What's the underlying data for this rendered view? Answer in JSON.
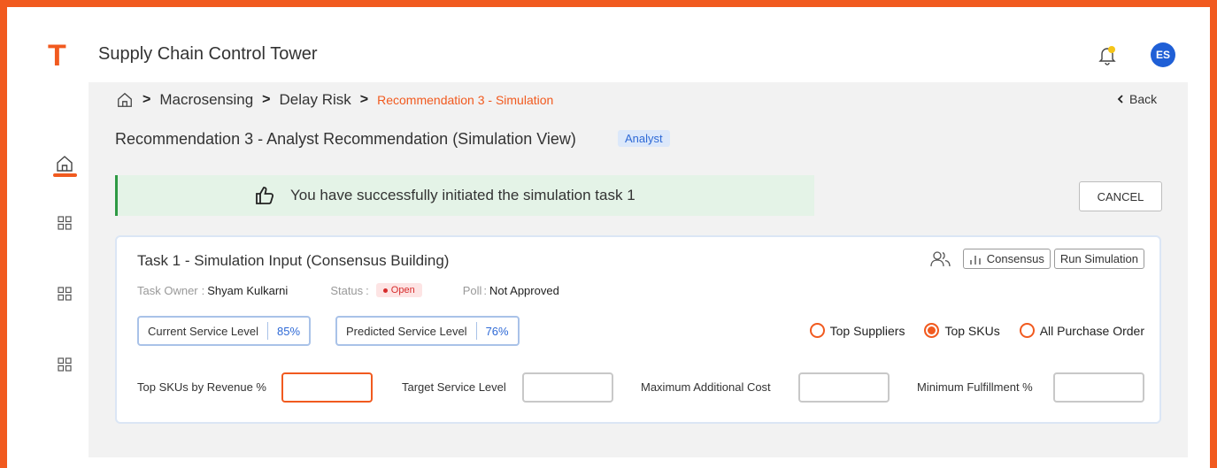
{
  "header": {
    "logo": "T",
    "title": "Supply Chain Control Tower",
    "avatar_initials": "ES",
    "notification_badge_color": "#f5c518"
  },
  "sidebar": {
    "items": [
      {
        "icon": "home-icon",
        "active": true
      },
      {
        "icon": "grid-icon",
        "active": false
      },
      {
        "icon": "grid-icon",
        "active": false
      },
      {
        "icon": "grid-icon",
        "active": false
      }
    ]
  },
  "breadcrumb": {
    "items": [
      "Macrosensing",
      "Delay Risk"
    ],
    "current": "Recommendation 3 - Simulation",
    "sep": ">"
  },
  "back_label": "Back",
  "page": {
    "title": "Recommendation 3 - Analyst Recommendation (Simulation View)",
    "role_badge": "Analyst"
  },
  "alert": {
    "message": "You have successfully initiated the simulation task 1"
  },
  "cancel_label": "CANCEL",
  "task": {
    "title": "Task 1 - Simulation Input (Consensus Building)",
    "consensus_label": "Consensus",
    "run_label": "Run Simulation",
    "owner_label": "Task Owner",
    "owner_value": "Shyam Kulkarni",
    "status_label": "Status",
    "status_value": "Open",
    "poll_label": "Poll",
    "poll_value": "Not Approved",
    "current_level_label": "Current Service Level",
    "current_level_value": "85%",
    "predicted_level_label": "Predicted Service Level",
    "predicted_level_value": "76%",
    "radios": [
      {
        "label": "Top Suppliers",
        "selected": false
      },
      {
        "label": "Top SKUs",
        "selected": true
      },
      {
        "label": "All Purchase Order",
        "selected": false
      }
    ],
    "fields": [
      {
        "label": "Top SKUs by Revenue %",
        "value": ""
      },
      {
        "label": "Target Service Level",
        "value": ""
      },
      {
        "label": "Maximum Additional Cost",
        "value": ""
      },
      {
        "label": "Minimum Fulfillment %",
        "value": ""
      }
    ]
  },
  "colors": {
    "accent": "#f15a1f",
    "primary_blue": "#1f5fd6",
    "success_bg": "#e4f3e7",
    "success_border": "#2e9a44"
  }
}
